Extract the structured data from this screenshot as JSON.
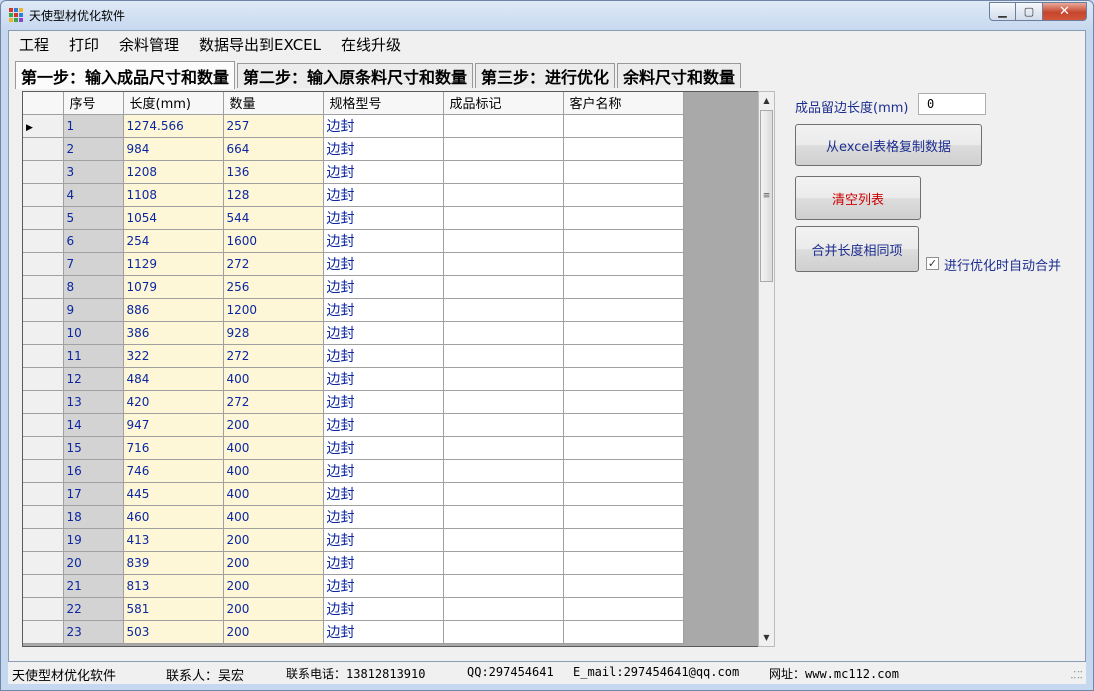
{
  "window": {
    "title": "天使型材优化软件"
  },
  "menu": [
    "工程",
    "打印",
    "余料管理",
    "数据导出到EXCEL",
    "在线升级"
  ],
  "tabs": [
    "第一步：输入成品尺寸和数量",
    "第二步：输入原条料尺寸和数量",
    "第三步：进行优化",
    "余料尺寸和数量"
  ],
  "grid": {
    "columns": [
      "序号",
      "长度(mm)",
      "数量",
      "规格型号",
      "成品标记",
      "客户名称"
    ],
    "current_row_marker": "▶",
    "rows": [
      [
        "1",
        "1274.566",
        "257",
        "边封",
        "",
        ""
      ],
      [
        "2",
        "984",
        "664",
        "边封",
        "",
        ""
      ],
      [
        "3",
        "1208",
        "136",
        "边封",
        "",
        ""
      ],
      [
        "4",
        "1108",
        "128",
        "边封",
        "",
        ""
      ],
      [
        "5",
        "1054",
        "544",
        "边封",
        "",
        ""
      ],
      [
        "6",
        "254",
        "1600",
        "边封",
        "",
        ""
      ],
      [
        "7",
        "1129",
        "272",
        "边封",
        "",
        ""
      ],
      [
        "8",
        "1079",
        "256",
        "边封",
        "",
        ""
      ],
      [
        "9",
        "886",
        "1200",
        "边封",
        "",
        ""
      ],
      [
        "10",
        "386",
        "928",
        "边封",
        "",
        ""
      ],
      [
        "11",
        "322",
        "272",
        "边封",
        "",
        ""
      ],
      [
        "12",
        "484",
        "400",
        "边封",
        "",
        ""
      ],
      [
        "13",
        "420",
        "272",
        "边封",
        "",
        ""
      ],
      [
        "14",
        "947",
        "200",
        "边封",
        "",
        ""
      ],
      [
        "15",
        "716",
        "400",
        "边封",
        "",
        ""
      ],
      [
        "16",
        "746",
        "400",
        "边封",
        "",
        ""
      ],
      [
        "17",
        "445",
        "400",
        "边封",
        "",
        ""
      ],
      [
        "18",
        "460",
        "400",
        "边封",
        "",
        ""
      ],
      [
        "19",
        "413",
        "200",
        "边封",
        "",
        ""
      ],
      [
        "20",
        "839",
        "200",
        "边封",
        "",
        ""
      ],
      [
        "21",
        "813",
        "200",
        "边封",
        "",
        ""
      ],
      [
        "22",
        "581",
        "200",
        "边封",
        "",
        ""
      ],
      [
        "23",
        "503",
        "200",
        "边封",
        "",
        ""
      ]
    ]
  },
  "panel": {
    "margin_label": "成品留边长度(mm)",
    "margin_value": "0",
    "copy_excel_button": "从excel表格复制数据",
    "clear_button": "清空列表",
    "merge_button": "合并长度相同项",
    "auto_merge_label": "进行优化时自动合并",
    "auto_merge_checked": true
  },
  "status": {
    "app_name": "天使型材优化软件",
    "contact": "联系人：吴宏",
    "phone": "联系电话：13812813910",
    "qq": "QQ:297454641",
    "email": "E_mail:297454641@qq.com",
    "website": "网址：www.mc112.com"
  },
  "colors": {
    "accent_text": "#1c2d8f",
    "clear_button_text": "#cc0000",
    "cell_number_text": "#0c27a0",
    "length_column_bg": "#fdf7d8"
  },
  "icons": {
    "app": "app-grid-icon",
    "minimize": "minimize-icon",
    "maximize": "maximize-icon",
    "close": "close-icon"
  }
}
